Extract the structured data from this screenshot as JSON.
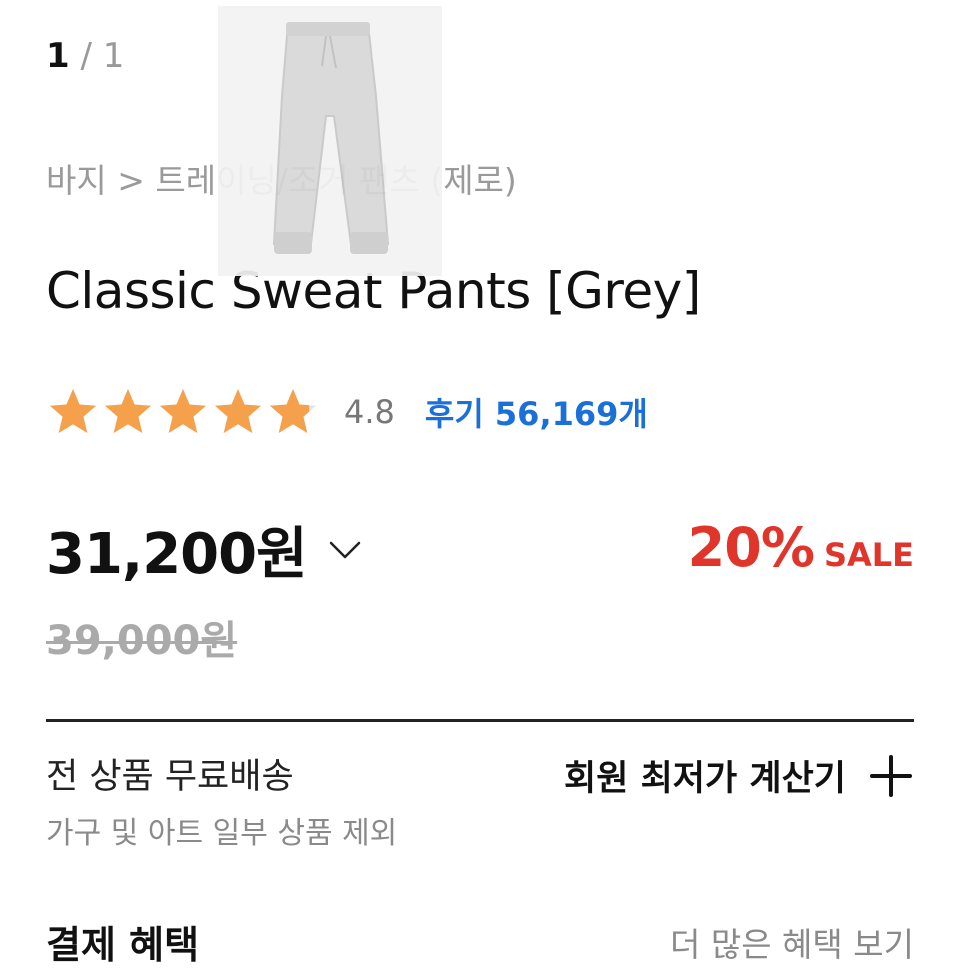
{
  "gallery": {
    "current": "1",
    "separator": " / ",
    "total": "1"
  },
  "breadcrumb": "바지 > 트레이닝/조거 팬츠 (제로)",
  "product": {
    "title": "Classic Sweat Pants [Grey]",
    "rating": "4.8",
    "rating_stars": 4.8,
    "reviews": "후기 56,169개"
  },
  "price": {
    "current": "31,200원",
    "original": "39,000원",
    "discount": "20%",
    "sale_label": "SALE"
  },
  "shipping": {
    "title": "전 상품 무료배송",
    "note": "가구 및 아트 일부 상품 제외",
    "calc_label": "회원 최저가 계산기"
  },
  "benefit": {
    "title": "결제 혜택",
    "more": "더 많은 혜택 보기"
  },
  "colors": {
    "star": "#f5a04a",
    "link": "#1b6fd8",
    "sale": "#e0352b"
  }
}
